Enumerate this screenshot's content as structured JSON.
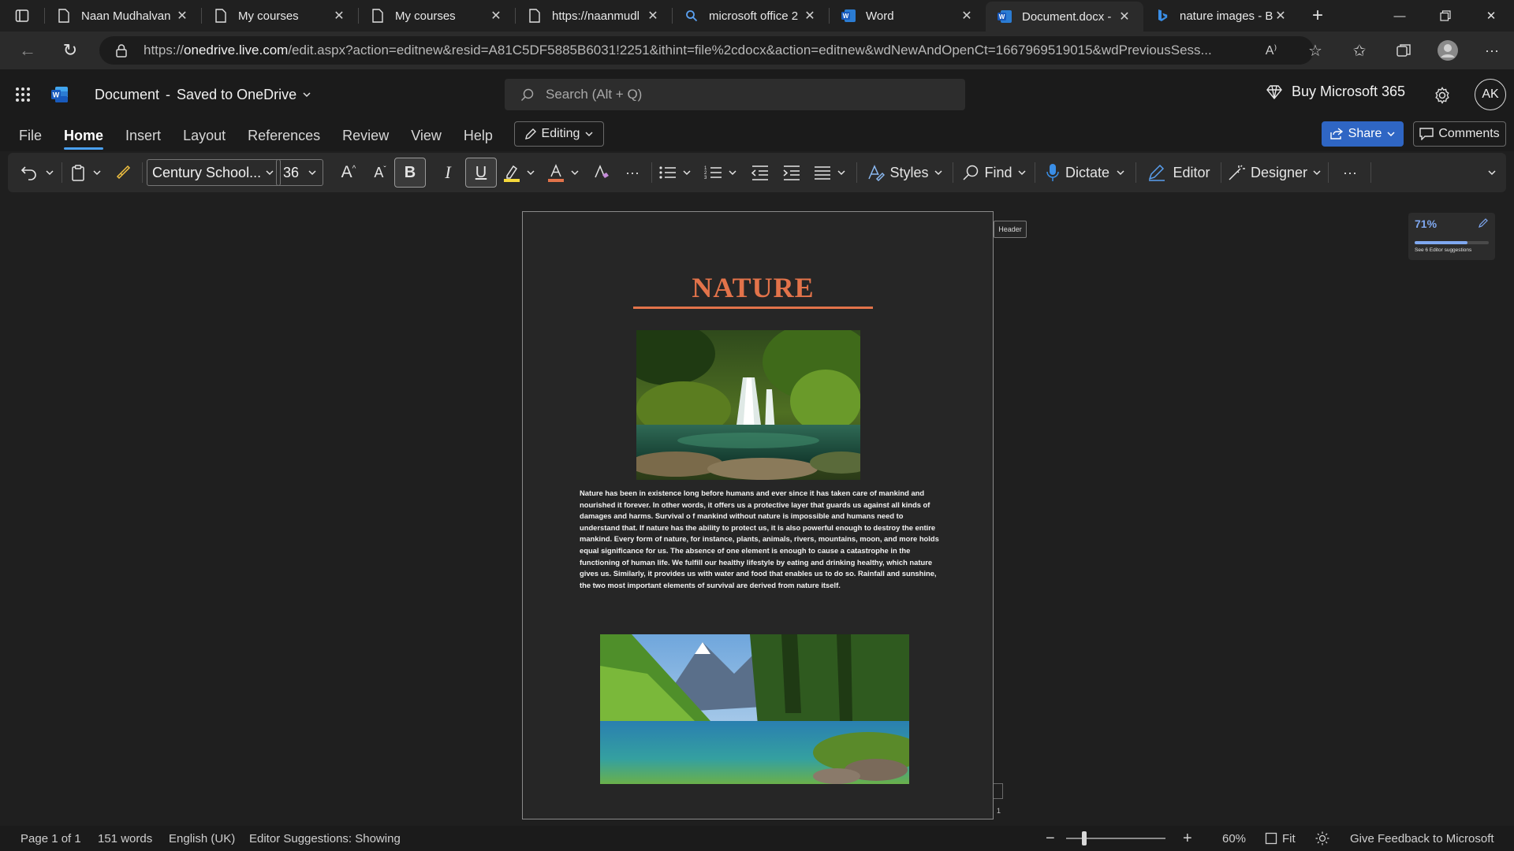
{
  "browser": {
    "tabs": [
      {
        "label": "Naan Mudhalvan",
        "icon": "page-icon",
        "active": false
      },
      {
        "label": "My courses",
        "icon": "page-icon",
        "active": false
      },
      {
        "label": "My courses",
        "icon": "page-icon",
        "active": false
      },
      {
        "label": "https://naanmudl",
        "icon": "page-icon",
        "active": false
      },
      {
        "label": "microsoft office 2",
        "icon": "search-icon",
        "active": false
      },
      {
        "label": "Word",
        "icon": "word-icon",
        "active": false
      },
      {
        "label": "Document.docx -",
        "icon": "word-icon",
        "active": true
      },
      {
        "label": "nature images - B",
        "icon": "bing-icon",
        "active": false
      }
    ],
    "url_prefix": "https://",
    "url_host": "onedrive.live.com",
    "url_rest": "/edit.aspx?action=editnew&resid=A81C5DF5885B6031!2251&ithint=file%2cdocx&action=editnew&wdNewAndOpenCt=1667969519015&wdPreviousSess..."
  },
  "app": {
    "doc_name": "Document",
    "separator": "-",
    "save_status": "Saved to OneDrive",
    "search_placeholder": "Search (Alt + Q)",
    "buy_label": "Buy Microsoft 365",
    "avatar_initials": "AK"
  },
  "menu": {
    "tabs": [
      "File",
      "Home",
      "Insert",
      "Layout",
      "References",
      "Review",
      "View",
      "Help"
    ],
    "active": "Home",
    "editing_label": "Editing",
    "share_label": "Share",
    "comments_label": "Comments"
  },
  "ribbon": {
    "font_name": "Century School...",
    "font_size": "36",
    "styles_label": "Styles",
    "find_label": "Find",
    "dictate_label": "Dictate",
    "editor_label": "Editor",
    "designer_label": "Designer",
    "accent_color": "#f5d93b",
    "font_color": "#e2734a"
  },
  "document": {
    "header_tag": "Header",
    "heading": "NATURE",
    "heading_color": "#e2734a",
    "body": "Nature has been in existence long before humans and ever since it has taken care of mankind and nourished it forever. In other words, it offers us a protective layer that guards us against all kinds of damages and harms. Survival o  f mankind without nature is impossible and humans need to understand that. If nature has the ability to protect us, it is also powerful enough to destroy the entire mankind. Every form of nature, for instance, plants, animals, rivers, mountains, moon, and more holds equal significance for us. The absence of one element is enough to cause a catastrophe in the functioning of human life. We fulfill our healthy lifestyle by eating and drinking healthy, which nature gives us. Similarly, it provides us with water and food that enables us to do so. Rainfall and sunshine, the two most important elements of survival are derived from nature itself.",
    "page_marker": "1"
  },
  "editor_card": {
    "score": "71%",
    "score_fraction": 0.71,
    "suggestions": "See 6 Editor suggestions"
  },
  "status": {
    "page": "Page 1 of 1",
    "words": "151 words",
    "language": "English (UK)",
    "editor_status": "Editor Suggestions: Showing",
    "zoom": "60%",
    "fit_label": "Fit",
    "feedback": "Give Feedback to Microsoft"
  }
}
